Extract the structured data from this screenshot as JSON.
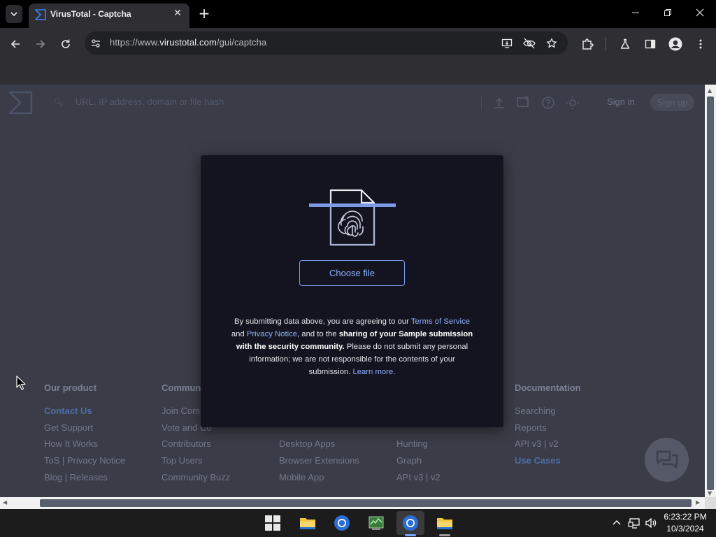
{
  "browser": {
    "tab_title": "VirusTotal - Captcha",
    "url_prefix": "https://www.",
    "url_domain": "virustotal.com",
    "url_path": "/gui/captcha",
    "tab_list_icon": "chevron-down-icon",
    "new_tab_label": "+"
  },
  "site_header": {
    "search_placeholder": "URL, IP address, domain or file hash",
    "sign_in_label": "Sign in",
    "sign_up_label": "Sign up"
  },
  "modal": {
    "choose_file_label": "Choose file",
    "text_1": "By submitting data above, you are agreeing to our ",
    "terms_link": "Terms of Service",
    "text_2": " and ",
    "privacy_link": "Privacy Notice",
    "text_3": ", and to the ",
    "bold_text": "sharing of your Sample submission with the security community.",
    "text_4": " Please do not submit any personal information; we are not responsible for the contents of your submission. ",
    "learn_more_link": "Learn more."
  },
  "footer": {
    "columns": [
      {
        "heading": "Our product",
        "links": [
          "Contact Us",
          "Get Support",
          "How It Works",
          "ToS | Privacy Notice",
          "Blog | Releases"
        ]
      },
      {
        "heading": "Commun",
        "links": [
          "Join Com",
          "Vote and Co",
          "Contributors",
          "Top Users",
          "Community Buzz"
        ]
      },
      {
        "heading": "",
        "links": [
          "",
          "",
          "Desktop Apps",
          "Browser Extensions",
          "Mobile App"
        ]
      },
      {
        "heading": "",
        "links": [
          "",
          "",
          "Hunting",
          "Graph",
          "API v3 | v2"
        ]
      },
      {
        "heading": "Documentation",
        "links": [
          "Searching",
          "Reports",
          "API v3 | v2",
          "Use Cases"
        ]
      }
    ]
  },
  "taskbar": {
    "time": "6:23:22 PM",
    "date": "10/3/2024"
  }
}
